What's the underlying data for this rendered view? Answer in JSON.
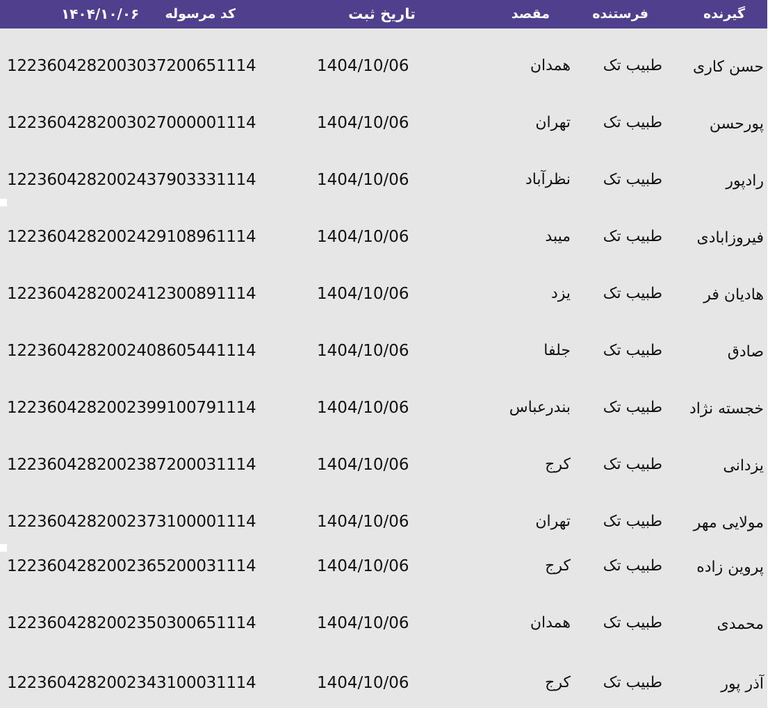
{
  "header": {
    "receiver": "گیرنده",
    "sender": "فرستنده",
    "destination": "مقصد",
    "registration_date": "تاریخ ثبت",
    "tracking_code": "کد مرسوله",
    "report_date": "۱۴۰۴/۱۰/۰۶"
  },
  "colors": {
    "header_bg": "#4f3f8c",
    "header_text": "#ffffff",
    "table_bg": "#e6e6e6"
  },
  "rows": [
    {
      "code": "1223604282003037200651114",
      "date": "1404/10/06",
      "destination": "همدان",
      "sender": "طبیب تک",
      "receiver": "حسن کاری"
    },
    {
      "code": "1223604282003027000001114",
      "date": "1404/10/06",
      "destination": "تهران",
      "sender": "طبیب تک",
      "receiver": "پورحسن"
    },
    {
      "code": "1223604282002437903331114",
      "date": "1404/10/06",
      "destination": "نظرآباد",
      "sender": "طبیب تک",
      "receiver": "رادپور"
    },
    {
      "code": "1223604282002429108961114",
      "date": "1404/10/06",
      "destination": "میبد",
      "sender": "طبیب تک",
      "receiver": "فیروزابادی"
    },
    {
      "code": "1223604282002412300891114",
      "date": "1404/10/06",
      "destination": "یزد",
      "sender": "طبیب تک",
      "receiver": "هادیان فر"
    },
    {
      "code": "1223604282002408605441114",
      "date": "1404/10/06",
      "destination": "جلفا",
      "sender": "طبیب تک",
      "receiver": "صادق"
    },
    {
      "code": "1223604282002399100791114",
      "date": "1404/10/06",
      "destination": "بندرعباس",
      "sender": "طبیب تک",
      "receiver": "خجسته نژاد"
    },
    {
      "code": "1223604282002387200031114",
      "date": "1404/10/06",
      "destination": "کرج",
      "sender": "طبیب تک",
      "receiver": "یزدانی"
    },
    {
      "code": "1223604282002373100001114",
      "date": "1404/10/06",
      "destination": "تهران",
      "sender": "طبیب تک",
      "receiver": "مولایی مهر"
    },
    {
      "code": "1223604282002365200031114",
      "date": "1404/10/06",
      "destination": "کرج",
      "sender": "طبیب تک",
      "receiver": "پروین زاده"
    },
    {
      "code": "1223604282002350300651114",
      "date": "1404/10/06",
      "destination": "همدان",
      "sender": "طبیب تک",
      "receiver": "محمدی"
    },
    {
      "code": "1223604282002343100031114",
      "date": "1404/10/06",
      "destination": "کرج",
      "sender": "طبیب تک",
      "receiver": "آذر پور"
    }
  ]
}
